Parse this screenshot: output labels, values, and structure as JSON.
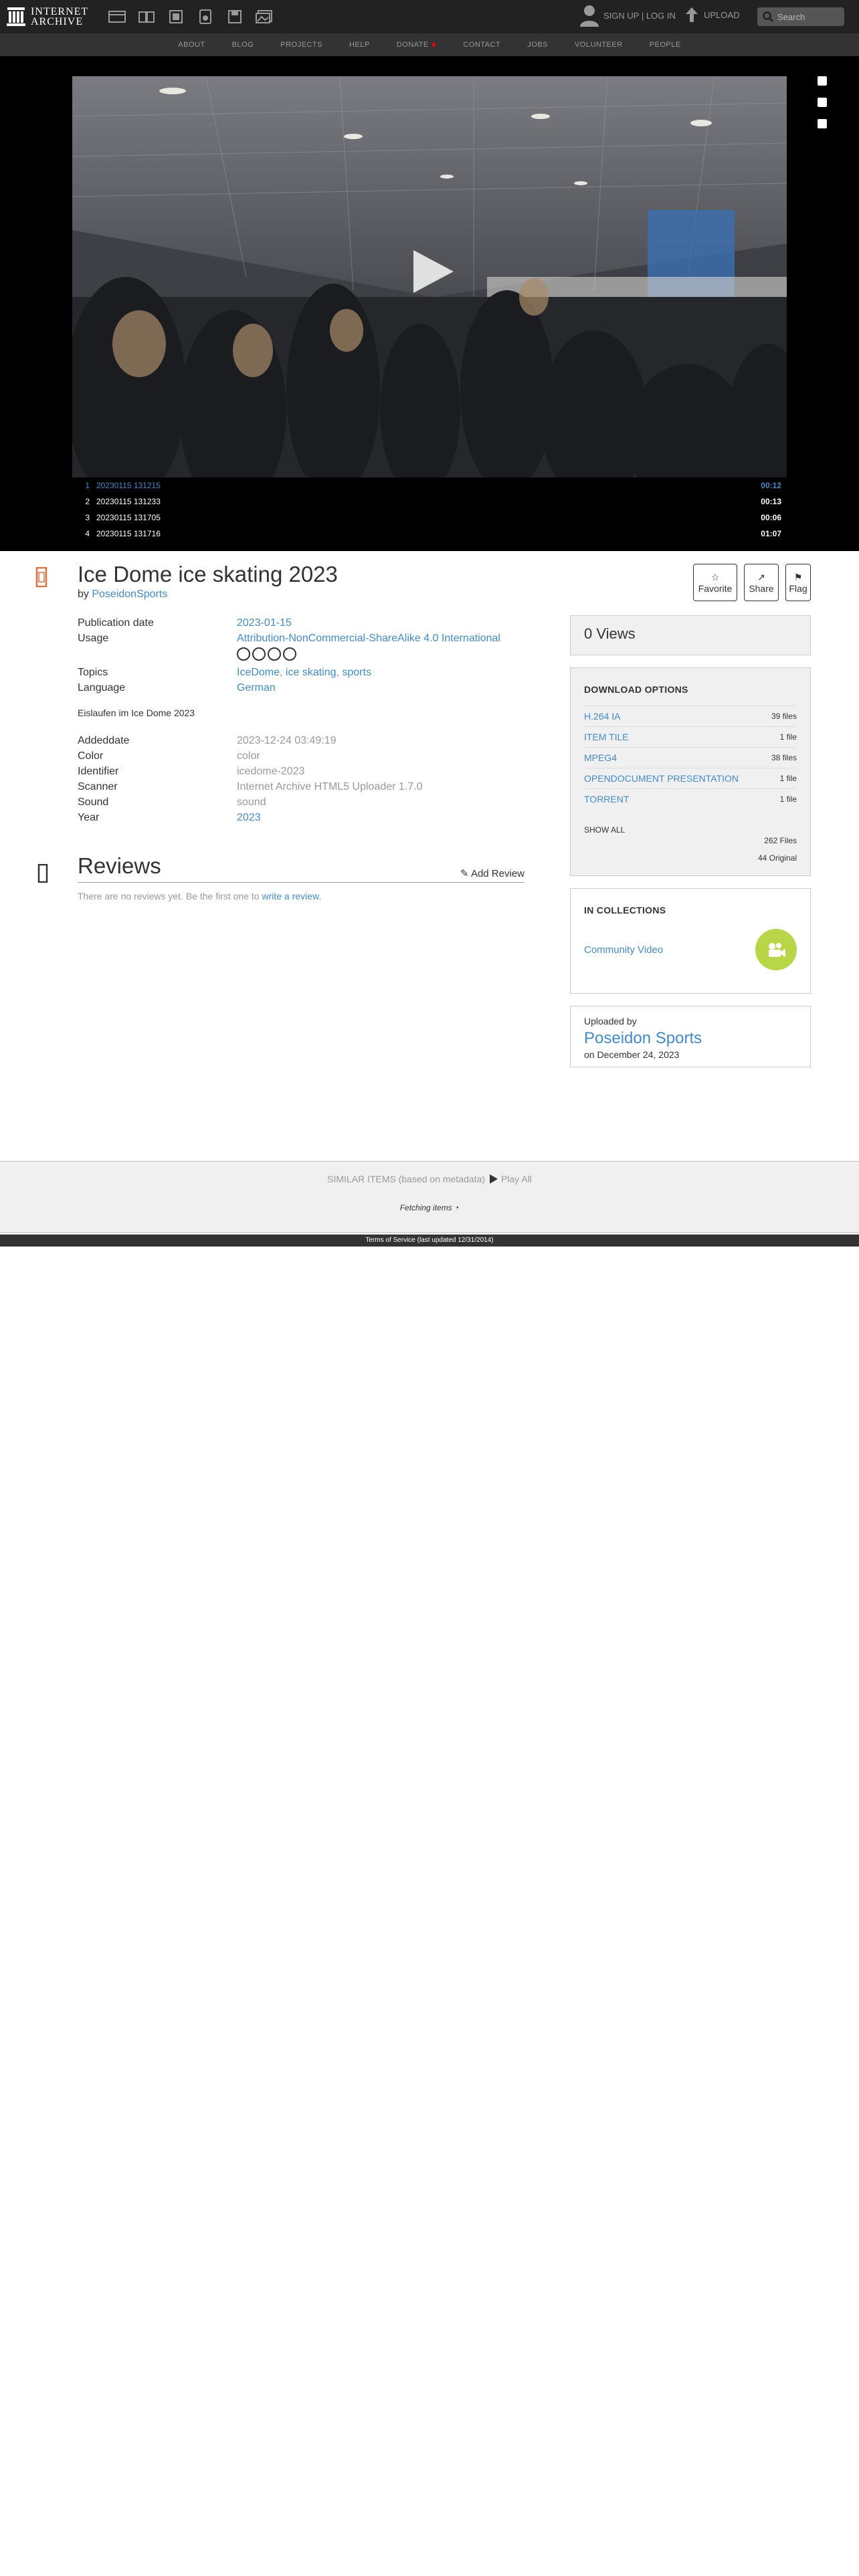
{
  "header": {
    "logo_line1": "INTERNET",
    "logo_line2": "ARCHIVE",
    "media_icons": [
      "web-icon",
      "texts-icon",
      "video-icon",
      "audio-icon",
      "software-icon",
      "images-icon"
    ],
    "signup_label": "SIGN UP | LOG IN",
    "upload_label": "UPLOAD",
    "search_placeholder": "Search"
  },
  "nav": [
    "ABOUT",
    "BLOG",
    "PROJECTS",
    "HELP",
    "DONATE",
    "CONTACT",
    "JOBS",
    "VOLUNTEER",
    "PEOPLE"
  ],
  "playlist": [
    {
      "num": "1",
      "name": "20230115 131215",
      "dur": "00:12"
    },
    {
      "num": "2",
      "name": "20230115 131233",
      "dur": "00:13"
    },
    {
      "num": "3",
      "name": "20230115 131705",
      "dur": "00:06"
    },
    {
      "num": "4",
      "name": "20230115 131716",
      "dur": "01:07"
    }
  ],
  "item": {
    "title": "Ice Dome ice skating 2023",
    "by_label": "by",
    "author": "PoseidonSports",
    "actions": [
      "Favorite",
      "Share",
      "Flag"
    ]
  },
  "metadata": {
    "publication_date_label": "Publication date",
    "publication_date": "2023-01-15",
    "usage_label": "Usage",
    "usage": "Attribution-NonCommercial-ShareAlike 4.0 International",
    "topics_label": "Topics",
    "topics": [
      "IceDome",
      "ice skating",
      "sports"
    ],
    "language_label": "Language",
    "language": "German",
    "description": "Eislaufen im Ice Dome 2023",
    "addeddate_label": "Addeddate",
    "addeddate": "2023-12-24 03:49:19",
    "color_label": "Color",
    "color": "color",
    "identifier_label": "Identifier",
    "identifier": "icedome-2023",
    "scanner_label": "Scanner",
    "scanner": "Internet Archive HTML5 Uploader 1.7.0",
    "sound_label": "Sound",
    "sound": "sound",
    "year_label": "Year",
    "year": "2023"
  },
  "reviews": {
    "title": "Reviews",
    "add_label": "Add Review",
    "empty_text": "There are no reviews yet. Be the first one to",
    "write_link": "write a review."
  },
  "sidebar": {
    "views": "0 Views",
    "download_title": "DOWNLOAD OPTIONS",
    "downloads": [
      {
        "label": "H.264 IA",
        "count": "39 files"
      },
      {
        "label": "ITEM TILE",
        "count": "1 file"
      },
      {
        "label": "MPEG4",
        "count": "38 files"
      },
      {
        "label": "OPENDOCUMENT PRESENTATION",
        "count": "1 file"
      },
      {
        "label": "TORRENT",
        "count": "1 file"
      }
    ],
    "show_all": "SHOW ALL",
    "total_files": "262 Files",
    "original_files": "44 Original",
    "collections_title": "IN COLLECTIONS",
    "collection": "Community Video",
    "uploaded_by_label": "Uploaded by",
    "uploader": "Poseidon Sports",
    "uploaded_on": "on December 24, 2023"
  },
  "similar": {
    "label": "SIMILAR ITEMS (based on metadata)",
    "play_all": "Play All",
    "fetching": "Fetching items"
  },
  "footer": "Terms of Service (last updated 12/31/2014)",
  "colors": {
    "link": "#428bca",
    "accent": "#b8d645",
    "topbar": "#222222"
  }
}
